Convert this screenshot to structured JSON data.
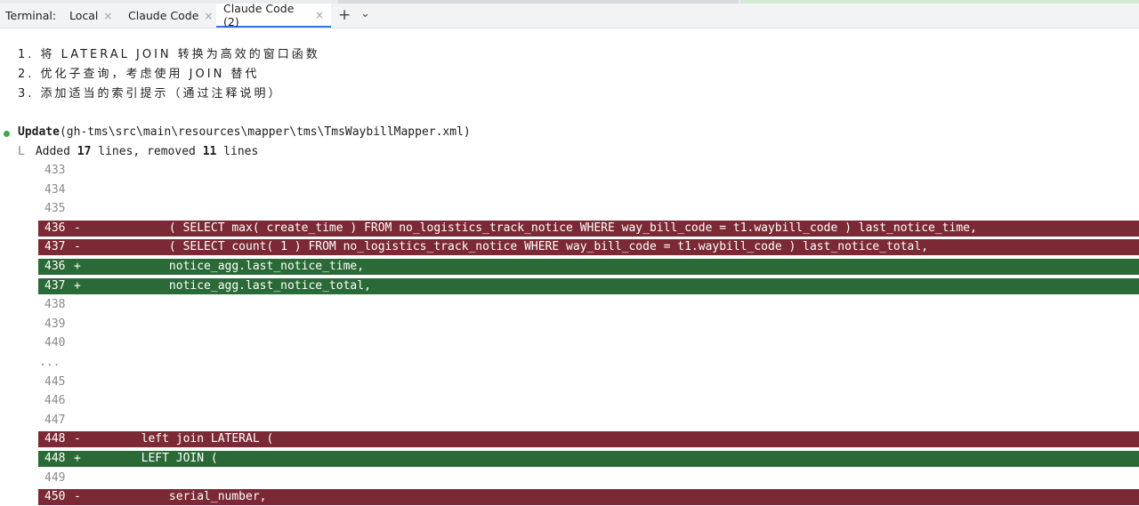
{
  "tabbar": {
    "label": "Terminal:",
    "tabs": [
      {
        "label": "Local"
      },
      {
        "label": "Claude Code"
      },
      {
        "label": "Claude Code (2)"
      }
    ],
    "close_glyph": "×",
    "plus_glyph": "+",
    "chevron_glyph": "⌄"
  },
  "plan": [
    "1. 将 LATERAL JOIN 转换为高效的窗口函数",
    "2. 优化子查询，考虑使用 JOIN 替代",
    "3. 添加适当的索引提示（通过注释说明）"
  ],
  "update": {
    "action": "Update",
    "path": "(gh-tms\\src\\main\\resources\\mapper\\tms\\TmsWaybillMapper.xml)",
    "corner": "L",
    "added_prefix": "Added ",
    "added_count": "17",
    "mid": " lines, removed ",
    "removed_count": "11",
    "suffix": " lines"
  },
  "diff": [
    {
      "num": "433",
      "mark": "",
      "code": "",
      "type": "ctx"
    },
    {
      "num": "434",
      "mark": "",
      "code": "",
      "type": "ctx"
    },
    {
      "num": "435",
      "mark": "",
      "code": "",
      "type": "ctx"
    },
    {
      "num": "436",
      "mark": "-",
      "code": "            ( SELECT max( create_time ) FROM no_logistics_track_notice WHERE way_bill_code = t1.waybill_code ) last_notice_time,",
      "type": "removed"
    },
    {
      "num": "437",
      "mark": "-",
      "code": "            ( SELECT count( 1 ) FROM no_logistics_track_notice WHERE way_bill_code = t1.waybill_code ) last_notice_total,",
      "type": "removed"
    },
    {
      "num": "436",
      "mark": "+",
      "code": "            notice_agg.last_notice_time,",
      "type": "added"
    },
    {
      "num": "437",
      "mark": "+",
      "code": "            notice_agg.last_notice_total,",
      "type": "added"
    },
    {
      "num": "438",
      "mark": "",
      "code": "",
      "type": "ctx"
    },
    {
      "num": "439",
      "mark": "",
      "code": "",
      "type": "ctx"
    },
    {
      "num": "440",
      "mark": "",
      "code": "",
      "type": "ctx"
    },
    {
      "num": "...",
      "mark": "",
      "code": "",
      "type": "ellipsis"
    },
    {
      "num": "445",
      "mark": "",
      "code": "",
      "type": "ctx"
    },
    {
      "num": "446",
      "mark": "",
      "code": "",
      "type": "ctx"
    },
    {
      "num": "447",
      "mark": "",
      "code": "",
      "type": "ctx"
    },
    {
      "num": "448",
      "mark": "-",
      "code": "        left join LATERAL (",
      "type": "removed"
    },
    {
      "num": "448",
      "mark": "+",
      "code": "        LEFT JOIN (",
      "type": "added"
    },
    {
      "num": "449",
      "mark": "",
      "code": "",
      "type": "ctx"
    },
    {
      "num": "450",
      "mark": "-",
      "code": "            serial_number,",
      "type": "removed"
    }
  ],
  "colors": {
    "removed_bg": "#7b2a35",
    "added_bg": "#2a6a36",
    "active_tab_underline": "#3574f0",
    "bullet": "#3fa84a"
  }
}
